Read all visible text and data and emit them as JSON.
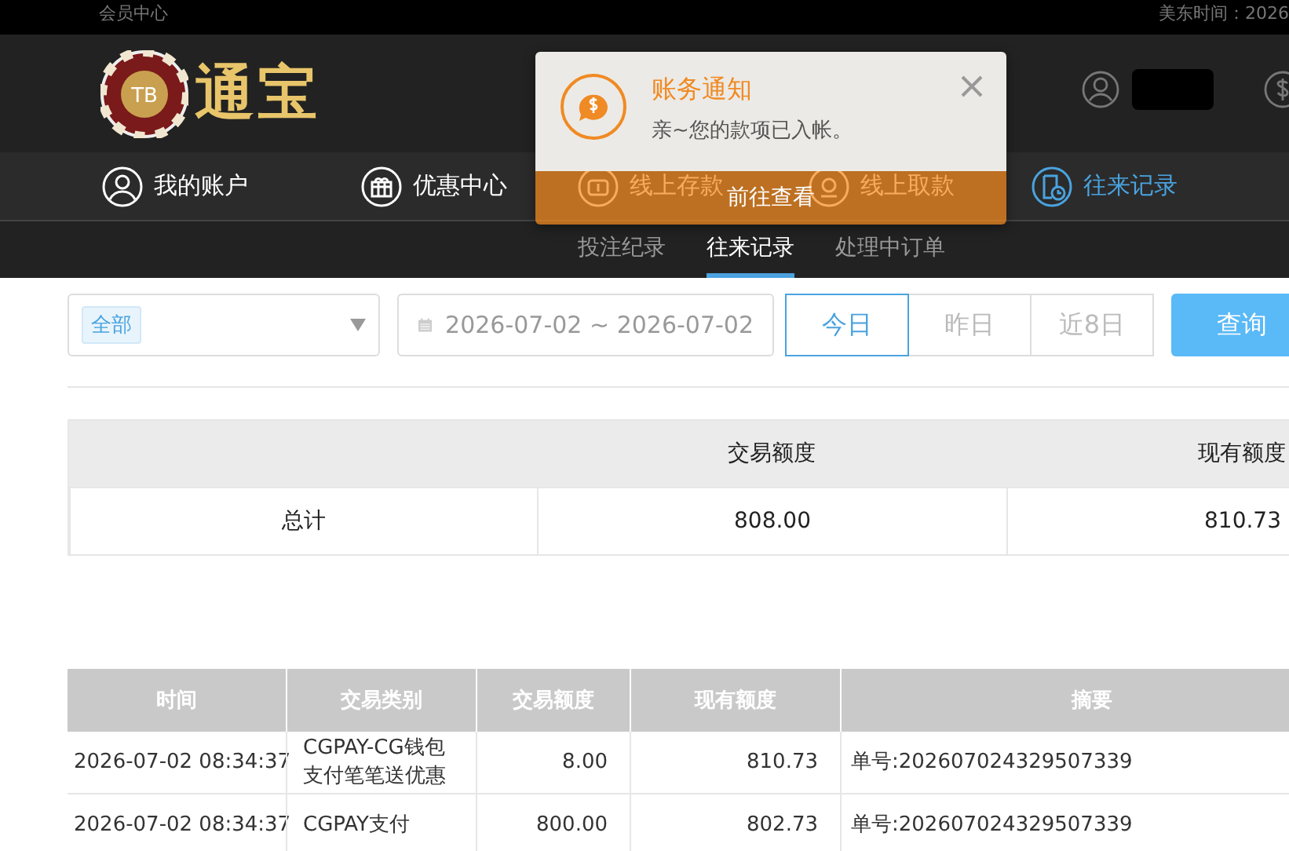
{
  "top_bar": {
    "left": "会员中心",
    "right": "美东时间：2026"
  },
  "logo": {
    "badge": "TB",
    "name": "通宝"
  },
  "nav": [
    {
      "label": "我的账户",
      "selected": false
    },
    {
      "label": "优惠中心",
      "selected": false
    },
    {
      "label": "线上存款",
      "selected": false
    },
    {
      "label": "线上取款",
      "selected": false
    },
    {
      "label": "往来记录",
      "selected": true
    }
  ],
  "sub_tabs": [
    {
      "label": "投注纪录",
      "selected": false
    },
    {
      "label": "往来记录",
      "selected": true
    },
    {
      "label": "处理中订单",
      "selected": false
    }
  ],
  "notification": {
    "title": "账务通知",
    "message": "亲~您的款项已入帐。",
    "action": "前往查看"
  },
  "filters": {
    "type_tag": "全部",
    "date_range": "2026-07-02 ~ 2026-07-02",
    "ranges": [
      {
        "label": "今日",
        "selected": true
      },
      {
        "label": "昨日",
        "selected": false
      },
      {
        "label": "近8日",
        "selected": false
      }
    ],
    "query": "查询"
  },
  "summary": {
    "columns": [
      "交易额度",
      "现有额度"
    ],
    "row": {
      "label": "总计",
      "values": [
        "808.00",
        "810.73"
      ]
    }
  },
  "table": {
    "columns": [
      "时间",
      "交易类别",
      "交易额度",
      "现有额度",
      "摘要"
    ],
    "rows": [
      [
        "2026-07-02 08:34:37",
        "CGPAY-CG钱包支付笔笔送优惠",
        "8.00",
        "810.73",
        "单号:202607024329507339"
      ],
      [
        "2026-07-02 08:34:37",
        "CGPAY支付",
        "800.00",
        "802.73",
        "单号:202607024329507339"
      ]
    ]
  }
}
